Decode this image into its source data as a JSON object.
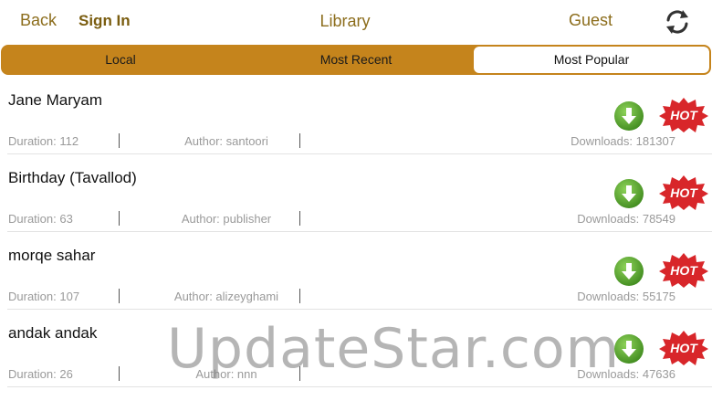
{
  "nav": {
    "back_label": "Back",
    "signin_label": "Sign In",
    "title": "Library",
    "user_label": "Guest"
  },
  "tabs": [
    {
      "label": "Local",
      "active": false
    },
    {
      "label": "Most Recent",
      "active": false
    },
    {
      "label": "Most Popular",
      "active": true
    }
  ],
  "songs": [
    {
      "title": "Jane Maryam",
      "duration": "Duration: 112",
      "author": "Author: santoori",
      "downloads": "Downloads: 181307"
    },
    {
      "title": "Birthday (Tavallod)",
      "duration": "Duration: 63",
      "author": "Author: publisher",
      "downloads": "Downloads: 78549"
    },
    {
      "title": "morqe sahar",
      "duration": "Duration: 107",
      "author": "Author: alizeyghami",
      "downloads": "Downloads: 55175"
    },
    {
      "title": "andak andak",
      "duration": "Duration: 26",
      "author": "Author: nnn",
      "downloads": "Downloads: 47636"
    }
  ],
  "badge_text": "HOT",
  "watermark": "UpdateStar.com",
  "colors": {
    "accent": "#c5841c",
    "nav_text": "#8c6d1c",
    "download_green": "#5aa62a",
    "hot_red": "#d8262a"
  },
  "icons": {
    "refresh": "refresh-icon",
    "download": "download-icon",
    "hot": "hot-badge-icon"
  }
}
